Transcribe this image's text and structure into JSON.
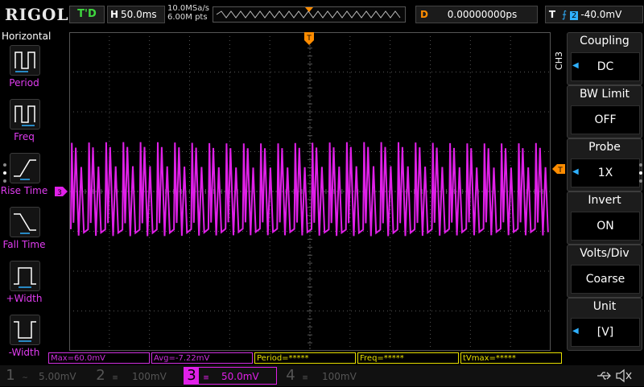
{
  "top": {
    "logo": "RIGOL",
    "trig_state": "T'D",
    "timebase_key": "H",
    "timebase": "50.0ms",
    "sample_rate": "10.0MSa/s",
    "mem_depth": "6.00M pts",
    "delay_key": "D",
    "delay": "0.00000000ps",
    "trig_key": "T",
    "trig_edge": "⨍",
    "trig_source": "2",
    "trig_level": "-40.0mV"
  },
  "left_menu": {
    "title": "Horizontal",
    "items": [
      {
        "label": "Period",
        "icon": "period-icon"
      },
      {
        "label": "Freq",
        "icon": "freq-icon"
      },
      {
        "label": "Rise Time",
        "icon": "rise-time-icon"
      },
      {
        "label": "Fall Time",
        "icon": "fall-time-icon"
      },
      {
        "label": "+Width",
        "icon": "pos-width-icon"
      },
      {
        "label": "-Width",
        "icon": "neg-width-icon"
      }
    ]
  },
  "right_menu": {
    "channel": "CH3",
    "items": [
      {
        "label": "Coupling",
        "value": "DC"
      },
      {
        "label": "BW Limit",
        "value": "OFF"
      },
      {
        "label": "Probe",
        "value": "1X"
      },
      {
        "label": "Invert",
        "value": "ON"
      },
      {
        "label": "Volts/Div",
        "value": "Coarse"
      },
      {
        "label": "Unit",
        "value": "[V]"
      }
    ]
  },
  "measurements": [
    {
      "text": "Max=60.0mV",
      "color": "#d030e0"
    },
    {
      "text": "Avg=-7.22mV",
      "color": "#d030e0"
    },
    {
      "text": "Period=*****",
      "color": "#e8e000"
    },
    {
      "text": "Freq=*****",
      "color": "#e8e000"
    },
    {
      "text": "tVmax=*****",
      "color": "#e8e000"
    }
  ],
  "channels": [
    {
      "num": "1",
      "coupling": "~",
      "scale": "5.00mV",
      "active": false
    },
    {
      "num": "2",
      "coupling": "≡",
      "scale": "100mV",
      "active": false
    },
    {
      "num": "3",
      "coupling": "≡",
      "scale": "50.0mV",
      "active": true
    },
    {
      "num": "4",
      "coupling": "≡",
      "scale": "100mV",
      "active": false
    }
  ],
  "colors": {
    "ch3": "#e020e8",
    "grid": "#555555",
    "trigger_marker": "#ff8c00",
    "accent_blue": "#2fb0ff",
    "trig_state_green": "#3fd83f"
  },
  "waveform": {
    "cycles": 28,
    "ch3_marker": "3",
    "trigger_marker": "T"
  },
  "status_icons": [
    "usb-icon",
    "speaker-muted-icon"
  ]
}
